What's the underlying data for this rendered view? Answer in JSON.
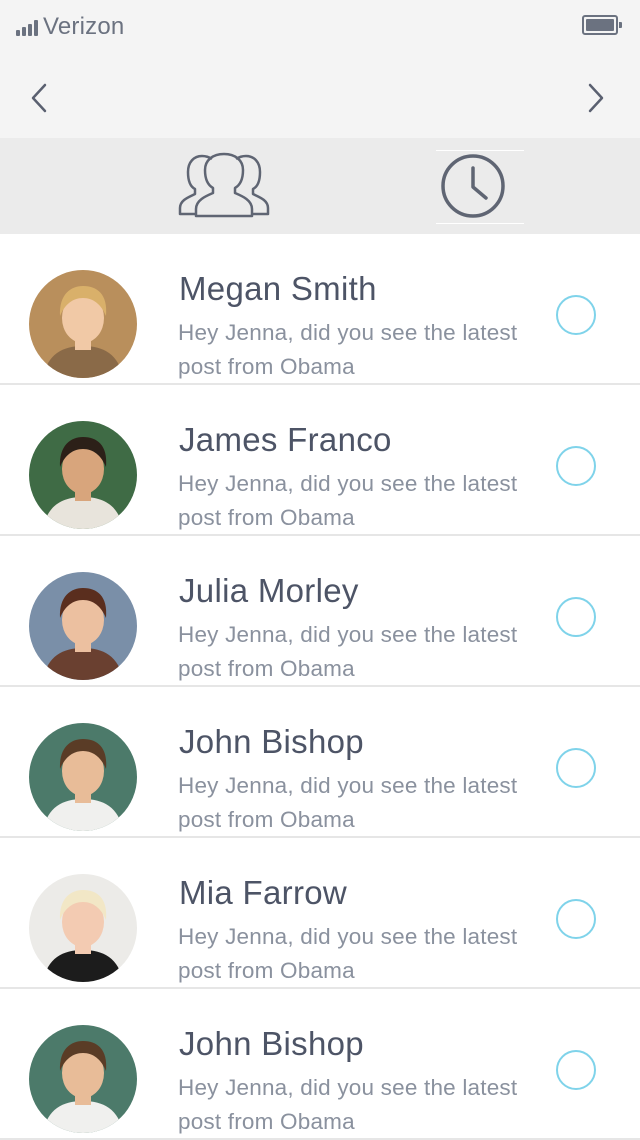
{
  "status_bar": {
    "carrier": "Verizon",
    "signal_icon": "signal-bars-icon",
    "battery_icon": "battery-full-icon"
  },
  "nav": {
    "back_icon": "chevron-left-icon",
    "forward_icon": "chevron-right-icon"
  },
  "tabs": [
    {
      "id": "contacts",
      "icon": "people-group-icon"
    },
    {
      "id": "recent",
      "icon": "clock-icon"
    }
  ],
  "colors": {
    "accent": "#7fd3ea",
    "bar_background": "#f4f4f4",
    "tab_background": "#ebebeb",
    "name_text": "#4d5466",
    "message_text": "#8a919e"
  },
  "conversations": [
    {
      "name": "Megan Smith",
      "message": "Hey Jenna, did you see the latest post from Obama",
      "avatar": "avatar-photo",
      "selected": false
    },
    {
      "name": "James Franco",
      "message": "Hey Jenna, did you see the latest post from Obama",
      "avatar": "avatar-photo",
      "selected": false
    },
    {
      "name": "Julia Morley",
      "message": "Hey Jenna, did you see the latest post from Obama",
      "avatar": "avatar-photo",
      "selected": false
    },
    {
      "name": "John Bishop",
      "message": "Hey Jenna, did you see the latest post from Obama",
      "avatar": "avatar-photo",
      "selected": false
    },
    {
      "name": "Mia Farrow",
      "message": "Hey Jenna, did you see the latest post from Obama",
      "avatar": "avatar-photo",
      "selected": false
    },
    {
      "name": "John Bishop",
      "message": "Hey Jenna, did you see the latest post from Obama",
      "avatar": "avatar-photo",
      "selected": false
    }
  ]
}
